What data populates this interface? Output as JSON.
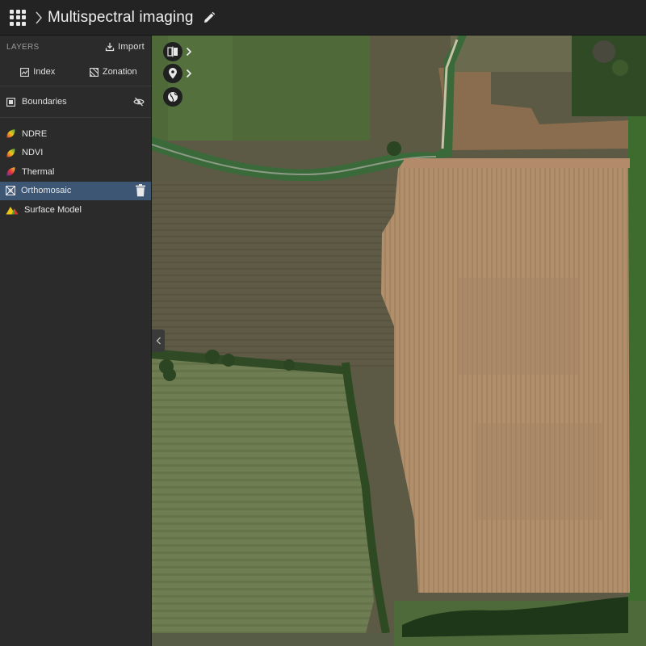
{
  "header": {
    "title": "Multispectral imaging",
    "apps_icon": "apps-grid-icon",
    "edit_icon": "pencil-icon"
  },
  "sidebar": {
    "section_label": "LAYERS",
    "import_label": "Import",
    "tabs": [
      {
        "label": "Index",
        "icon": "index-icon"
      },
      {
        "label": "Zonation",
        "icon": "zonation-icon"
      }
    ],
    "boundaries": {
      "label": "Boundaries",
      "visibility_icon": "eye-off-icon"
    },
    "layers": [
      {
        "label": "NDRE",
        "icon": "leaf-gradient-icon",
        "selected": false
      },
      {
        "label": "NDVI",
        "icon": "leaf-gradient-icon",
        "selected": false
      },
      {
        "label": "Thermal",
        "icon": "thermal-leaf-icon",
        "selected": false
      },
      {
        "label": "Orthomosaic",
        "icon": "orthomosaic-icon",
        "selected": true
      },
      {
        "label": "Surface Model",
        "icon": "terrain-icon",
        "selected": false
      }
    ]
  },
  "colors": {
    "selected_row": "#3c5674",
    "topbar": "#232323",
    "sidebar": "#2b2b2b"
  },
  "map_controls": [
    {
      "icon": "split-view-icon"
    },
    {
      "icon": "location-pin-icon"
    },
    {
      "icon": "globe-icon"
    }
  ]
}
